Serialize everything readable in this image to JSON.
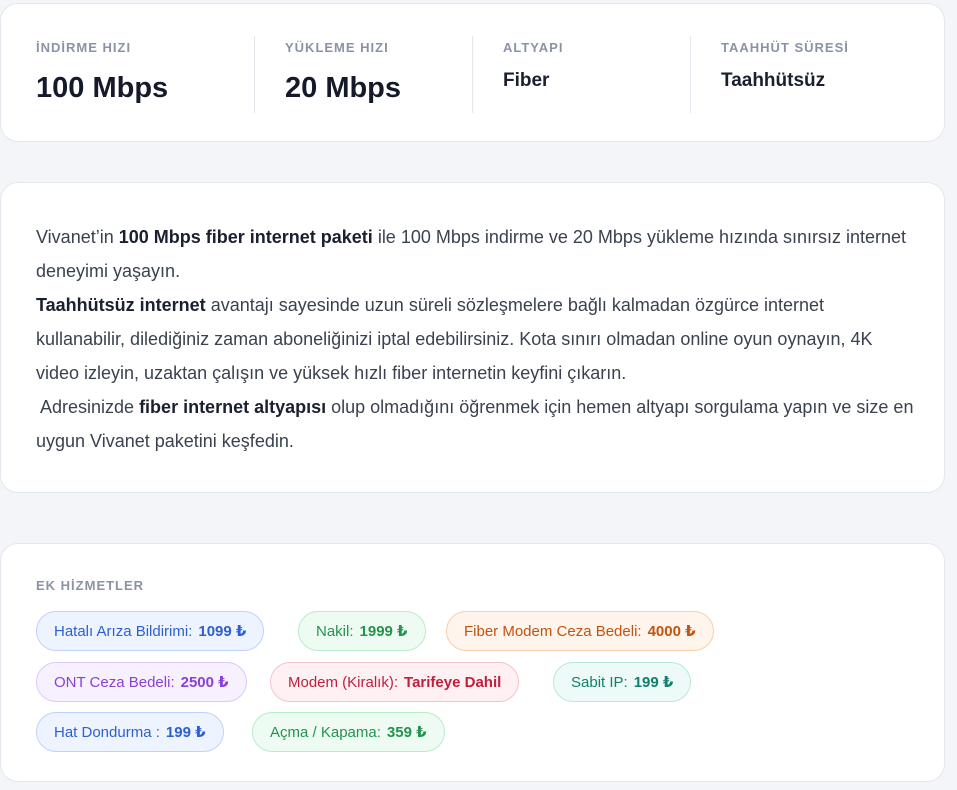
{
  "specs": {
    "download": {
      "label": "İNDİRME HIZI",
      "value": "100 Mbps"
    },
    "upload": {
      "label": "YÜKLEME HIZI",
      "value": "20 Mbps"
    },
    "infrastructure": {
      "label": "ALTYAPI",
      "value": "Fiber"
    },
    "commitment": {
      "label": "TAAHHÜT SÜRESİ",
      "value": "Taahhütsüz"
    }
  },
  "description": {
    "p1_pre": "Vivanet’in ",
    "p1_bold": "100 Mbps fiber internet paketi",
    "p1_post": " ile 100 Mbps indirme ve 20 Mbps yükleme hızında sınırsız internet deneyimi yaşayın.",
    "p2_bold": "Taahhütsüz internet",
    "p2_post": " avantajı sayesinde uzun süreli sözleşmelere bağlı kalmadan özgürce internet kullanabilir, dilediğiniz zaman aboneliğinizi iptal edebilirsiniz. Kota sınırı olmadan online oyun oynayın, 4K video izleyin, uzaktan çalışın ve yüksek hızlı fiber internetin keyfini çıkarın.",
    "p3_pre": " Adresinizde ",
    "p3_bold": "fiber internet altyapısı",
    "p3_post": " olup olmadığını öğrenmek için hemen altyapı sorgulama yapın ve size en uygun Vivanet paketini keşfedin."
  },
  "services": {
    "title": "EK HİZMETLER",
    "items": [
      {
        "label": "Hatalı Arıza Bildirimi:",
        "price": "1099 ₺",
        "color": "#2d5fd1"
      },
      {
        "label": "Nakil:",
        "price": "1999 ₺",
        "color": "#24934d"
      },
      {
        "label": "Fiber Modem Ceza Bedeli:",
        "price": "4000 ₺",
        "color": "#c4530f"
      },
      {
        "label": "ONT Ceza Bedeli:",
        "price": "2500 ₺",
        "color": "#8a3fd6"
      },
      {
        "label": "Modem (Kiralık):",
        "price": "Tarifeye Dahil",
        "color": "#c11e3e"
      },
      {
        "label": "Sabit IP:",
        "price": "199 ₺",
        "color": "#12806c"
      },
      {
        "label": "Hat Dondurma :",
        "price": "199 ₺",
        "color": "#2d5fd1"
      },
      {
        "label": "Açma / Kapama:",
        "price": "359 ₺",
        "color": "#24934d"
      }
    ]
  }
}
